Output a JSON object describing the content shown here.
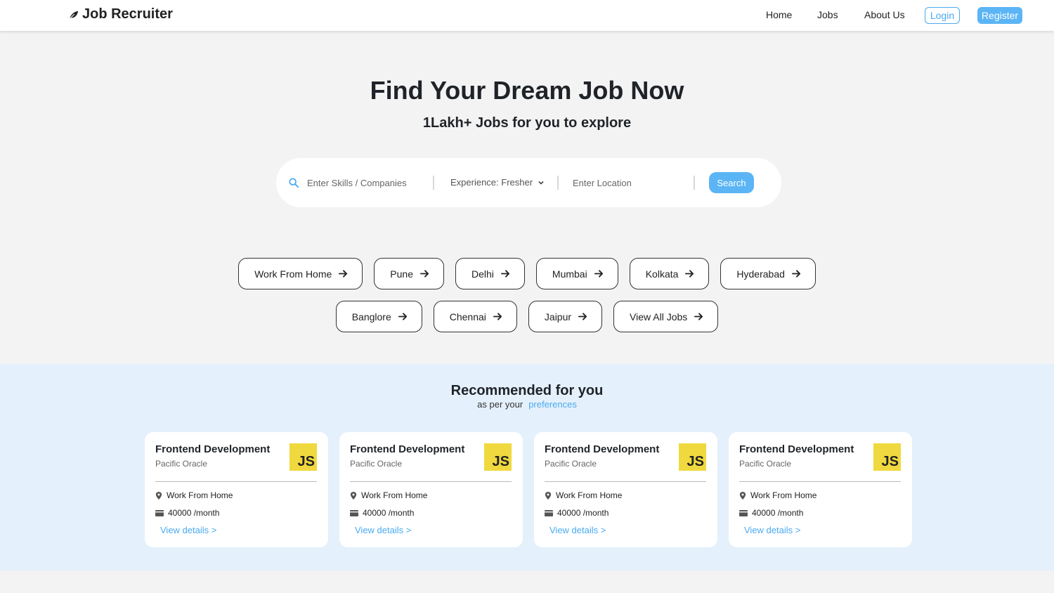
{
  "brand": {
    "name": "Job Recruiter",
    "icon": "leaf-icon"
  },
  "nav": {
    "home": "Home",
    "jobs": "Jobs",
    "about": "About Us",
    "login": "Login",
    "register": "Register"
  },
  "hero": {
    "title": "Find Your Dream Job Now",
    "subtitle": "1Lakh+ Jobs for you to explore"
  },
  "search": {
    "skills_placeholder": "Enter Skills / Companies",
    "experience_value": "Experience: Fresher",
    "location_placeholder": "Enter Location",
    "button": "Search"
  },
  "chips_row1": [
    "Work From Home",
    "Pune",
    "Delhi",
    "Mumbai",
    "Kolkata",
    "Hyderabad"
  ],
  "chips_row2": [
    "Banglore",
    "Chennai",
    "Jaipur",
    "View All Jobs"
  ],
  "recommended": {
    "title": "Recommended for you",
    "subtitle": "as per your",
    "link": "preferences"
  },
  "cards": [
    {
      "title": "Frontend Development",
      "company": "Pacific Oracle",
      "logo": "JS",
      "location": "Work From Home",
      "salary": "40000 /month",
      "link": "View details >"
    },
    {
      "title": "Frontend Development",
      "company": "Pacific Oracle",
      "logo": "JS",
      "location": "Work From Home",
      "salary": "40000 /month",
      "link": "View details >"
    },
    {
      "title": "Frontend Development",
      "company": "Pacific Oracle",
      "logo": "JS",
      "location": "Work From Home",
      "salary": "40000 /month",
      "link": "View details >"
    },
    {
      "title": "Frontend Development",
      "company": "Pacific Oracle",
      "logo": "JS",
      "location": "Work From Home",
      "salary": "40000 /month",
      "link": "View details >"
    }
  ],
  "colors": {
    "accent": "#5bb5f5",
    "link": "#4aaaf0",
    "js_yellow": "#f0d93e",
    "section_bg": "#e4f0fb"
  }
}
